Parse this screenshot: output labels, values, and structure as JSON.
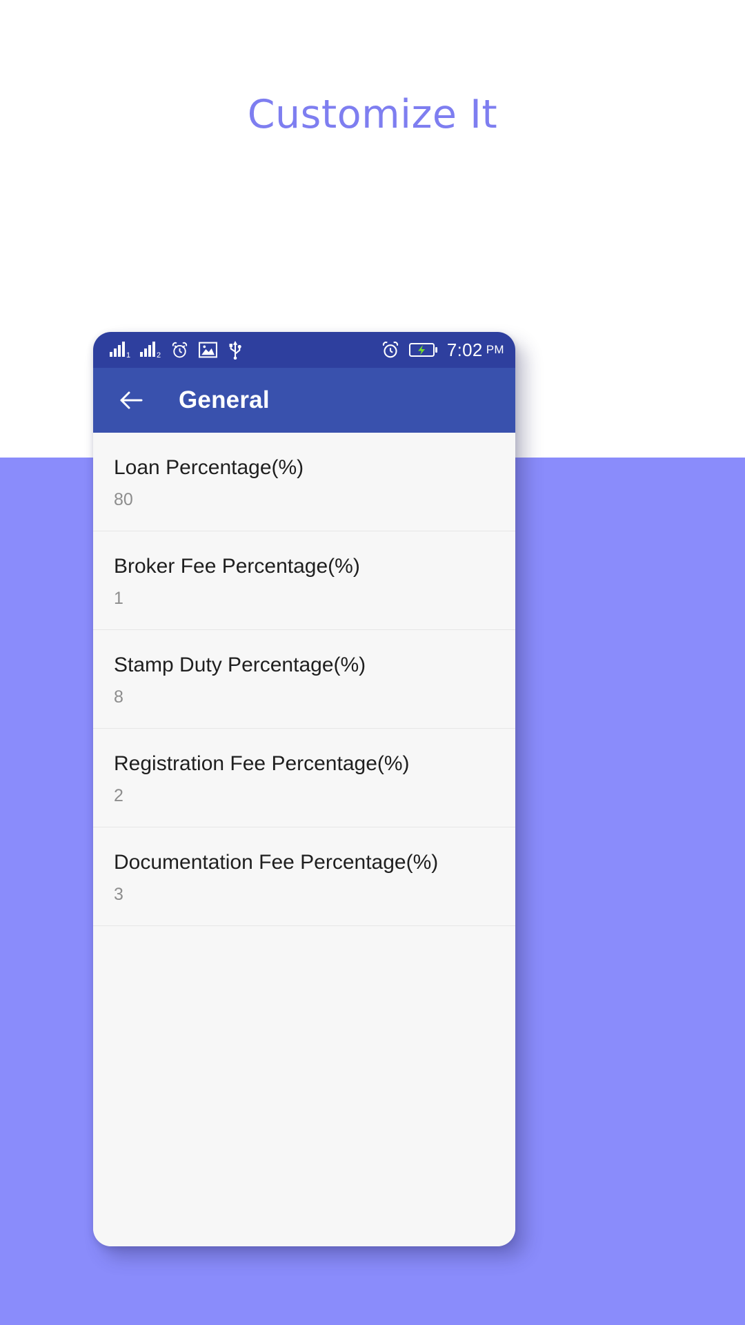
{
  "promo": {
    "title": "Customize It",
    "title_color": "#7e7ef0",
    "background_top_color": "#ffffff",
    "background_bottom_color": "#8a8cfb"
  },
  "status_bar": {
    "background_color": "#2e3f9e",
    "left_icons": [
      "signal-bars-sim1-icon",
      "signal-bars-sim2-icon",
      "alarm-clock-icon",
      "image-icon",
      "usb-icon"
    ],
    "right_icons": [
      "alarm-clock-icon",
      "battery-charging-icon"
    ],
    "battery_bolt_color": "#76e02a",
    "time": "7:02",
    "ampm": "PM"
  },
  "app_bar": {
    "background_color": "#3951ad",
    "back_icon": "arrow-left-icon",
    "title": "General"
  },
  "settings": {
    "items": [
      {
        "label": "Loan Percentage(%)",
        "value": "80"
      },
      {
        "label": "Broker Fee Percentage(%)",
        "value": "1"
      },
      {
        "label": "Stamp Duty Percentage(%)",
        "value": "8"
      },
      {
        "label": "Registration Fee Percentage(%)",
        "value": "2"
      },
      {
        "label": "Documentation Fee Percentage(%)",
        "value": "3"
      }
    ]
  }
}
